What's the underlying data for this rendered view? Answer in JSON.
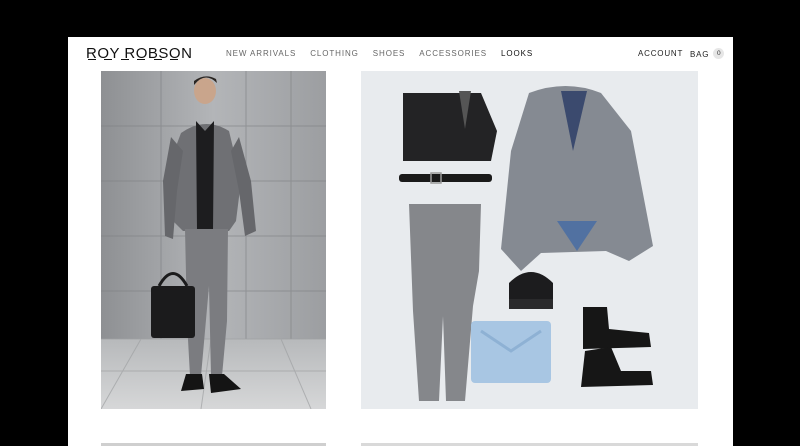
{
  "brand": {
    "name": "ROY ROBSON"
  },
  "nav": {
    "items": [
      {
        "label": "NEW ARRIVALS"
      },
      {
        "label": "CLOTHING"
      },
      {
        "label": "SHOES"
      },
      {
        "label": "ACCESSORIES"
      },
      {
        "label": "LOOKS"
      }
    ]
  },
  "header": {
    "account_label": "ACCOUNT",
    "bag_label": "BAG",
    "bag_count": "0"
  },
  "colors": {
    "background": "#ffffff",
    "frame": "#000000",
    "text_primary": "#111111",
    "text_muted": "#666666"
  }
}
